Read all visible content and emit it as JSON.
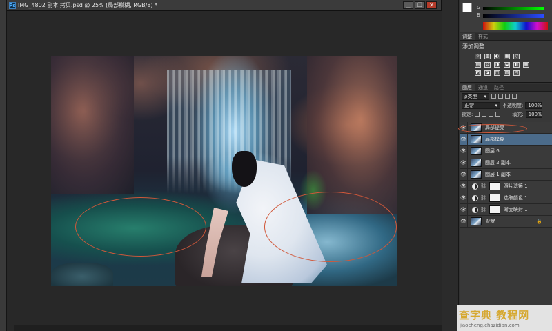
{
  "document": {
    "tab_title": "IMG_4802 副本 拷贝.psd @ 25% (局部模糊, RGB/8) *",
    "app_icon": "Ps",
    "controls": {
      "minimize": "▁",
      "restore": "❐",
      "close": "✕"
    }
  },
  "color_panel": {
    "g_label": "G",
    "b_label": "B"
  },
  "adjustments": {
    "tabs": [
      "调整",
      "样式"
    ],
    "title": "添加调整",
    "row1": [
      "☼",
      "▥",
      "◐",
      "▦",
      "▽"
    ],
    "row2": [
      "▤",
      "⚖",
      "◑",
      "◒",
      "◧",
      "▦"
    ],
    "row3": [
      "◩",
      "◪",
      "◫",
      "▨",
      "◰"
    ]
  },
  "layers_panel": {
    "tabs": [
      "图层",
      "通道",
      "路径"
    ],
    "filter_label": "ρ类型",
    "blend_mode": "正常",
    "opacity_label": "不透明度:",
    "opacity_value": "100%",
    "lock_label": "锁定:",
    "fill_label": "填充:",
    "fill_value": "100%",
    "layers": [
      {
        "name": "局部提亮",
        "selected": false,
        "type": "image"
      },
      {
        "name": "局部模糊",
        "selected": true,
        "type": "image"
      },
      {
        "name": "图层 6",
        "selected": false,
        "type": "image"
      },
      {
        "name": "图层 2 副本",
        "selected": false,
        "type": "image"
      },
      {
        "name": "图层 1 副本",
        "selected": false,
        "type": "image"
      },
      {
        "name": "照片滤镜 1",
        "selected": false,
        "type": "adjustment"
      },
      {
        "name": "选取颜色 1",
        "selected": false,
        "type": "adjustment"
      },
      {
        "name": "渐变映射 1",
        "selected": false,
        "type": "adjustment"
      },
      {
        "name": "背景",
        "selected": false,
        "type": "background"
      }
    ]
  },
  "watermark": {
    "line1": "查字典 教程网",
    "line2": "jiaocheng.chazidian.com"
  },
  "colors": {
    "accent_selected": "#4b6b8a",
    "annotation": "#d1583a"
  }
}
